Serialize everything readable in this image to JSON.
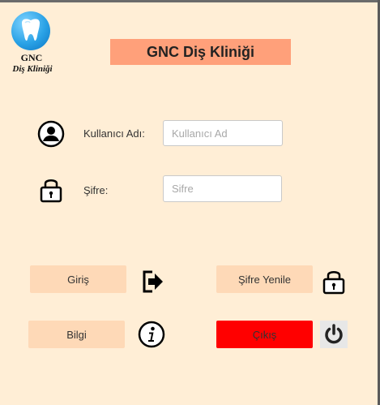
{
  "logo": {
    "line1": "GNC",
    "line2": "Diş Kliniği"
  },
  "header": {
    "title": "GNC Diş Kliniği"
  },
  "form": {
    "username": {
      "label": "Kullanıcı Adı:",
      "placeholder": "Kullanıcı Ad",
      "value": ""
    },
    "password": {
      "label": "Şifre:",
      "placeholder": "Sifre",
      "value": ""
    }
  },
  "buttons": {
    "login": "Giriş",
    "reset_password": "Şifre Yenile",
    "info": "Bilgi",
    "exit": "Çıkış"
  },
  "colors": {
    "background": "#ffeed6",
    "title_bg": "#ffa07a",
    "button_bg": "#fed9b7",
    "exit_bg": "#ff0000"
  },
  "icons": {
    "user": "user-icon",
    "password_lock": "lock-icon",
    "login": "sign-in-arrow-icon",
    "reset": "lock-icon",
    "info": "info-icon",
    "power": "power-icon"
  }
}
